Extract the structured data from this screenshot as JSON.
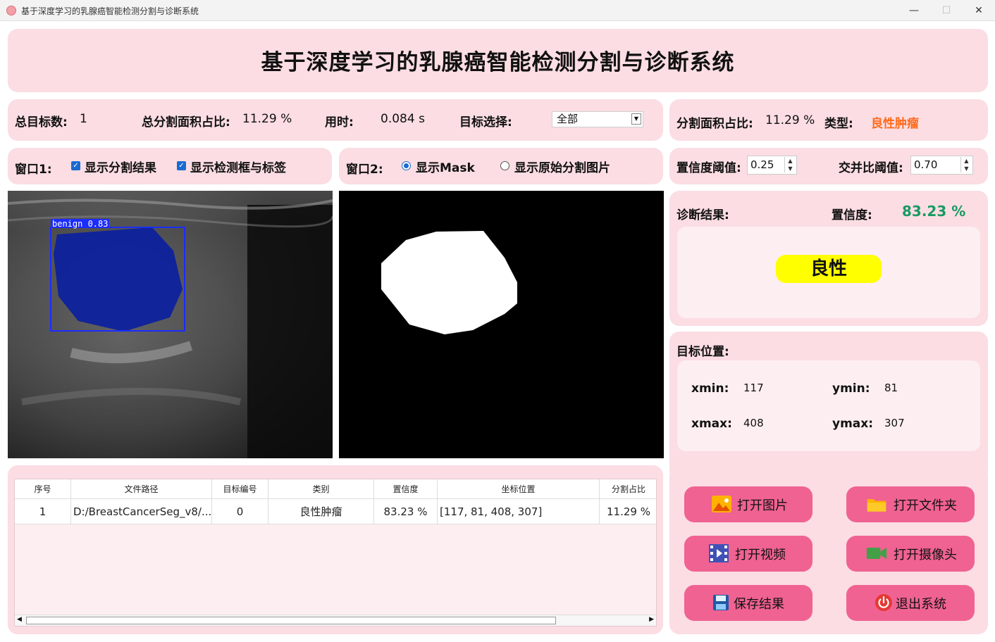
{
  "window": {
    "title": "基于深度学习的乳腺癌智能检测分割与诊断系统",
    "minimize": "—",
    "maximize": "☐",
    "close": "✕"
  },
  "header": {
    "title": "基于深度学习的乳腺癌智能检测分割与诊断系统"
  },
  "stats": {
    "total_label": "总目标数:",
    "total_value": "1",
    "area_label": "总分割面积占比:",
    "area_value": "11.29 %",
    "time_label": "用时:",
    "time_value": "0.084 s",
    "target_label": "目标选择:",
    "target_value": "全部"
  },
  "info": {
    "area_label": "分割面积占比:",
    "area_value": "11.29 %",
    "type_label": "类型:",
    "type_value": "良性肿瘤",
    "type_color": "#ff6a1a"
  },
  "window1": {
    "label": "窗口1:",
    "opt_seg": "显示分割结果",
    "opt_box": "显示检测框与标签"
  },
  "window2": {
    "label": "窗口2:",
    "opt_mask": "显示Mask",
    "opt_orig": "显示原始分割图片"
  },
  "thresholds": {
    "conf_label": "置信度阈值:",
    "conf_value": "0.25",
    "iou_label": "交并比阈值:",
    "iou_value": "0.70"
  },
  "detection": {
    "box_label": "benign  0.83"
  },
  "diagnosis": {
    "result_label": "诊断结果:",
    "conf_label": "置信度:",
    "conf_value": "83.23 %",
    "conf_color": "#1a9a63",
    "result_value": "良性",
    "badge_color": "#ffff00"
  },
  "position": {
    "label": "目标位置:",
    "xmin_label": "xmin:",
    "xmin": "117",
    "ymin_label": "ymin:",
    "ymin": "81",
    "xmax_label": "xmax:",
    "xmax": "408",
    "ymax_label": "ymax:",
    "ymax": "307"
  },
  "table": {
    "headers": [
      "序号",
      "文件路径",
      "目标编号",
      "类别",
      "置信度",
      "坐标位置",
      "分割占比"
    ],
    "rows": [
      [
        "1",
        "D:/BreastCancerSeg_v8/...",
        "0",
        "良性肿瘤",
        "83.23 %",
        "[117, 81, 408, 307]",
        "11.29 %"
      ]
    ]
  },
  "buttons": {
    "open_image": "打开图片",
    "open_folder": "打开文件夹",
    "open_video": "打开视频",
    "open_camera": "打开摄像头",
    "save": "保存结果",
    "exit": "退出系统"
  },
  "icons": {
    "image": "image-icon",
    "folder": "folder-icon",
    "video": "video-icon",
    "camera": "camera-icon",
    "save": "floppy-icon",
    "exit": "power-icon"
  },
  "colors": {
    "panel_bg": "#fbdde3",
    "button_bg": "#f06292",
    "checkbox": "#1a6bd0"
  }
}
